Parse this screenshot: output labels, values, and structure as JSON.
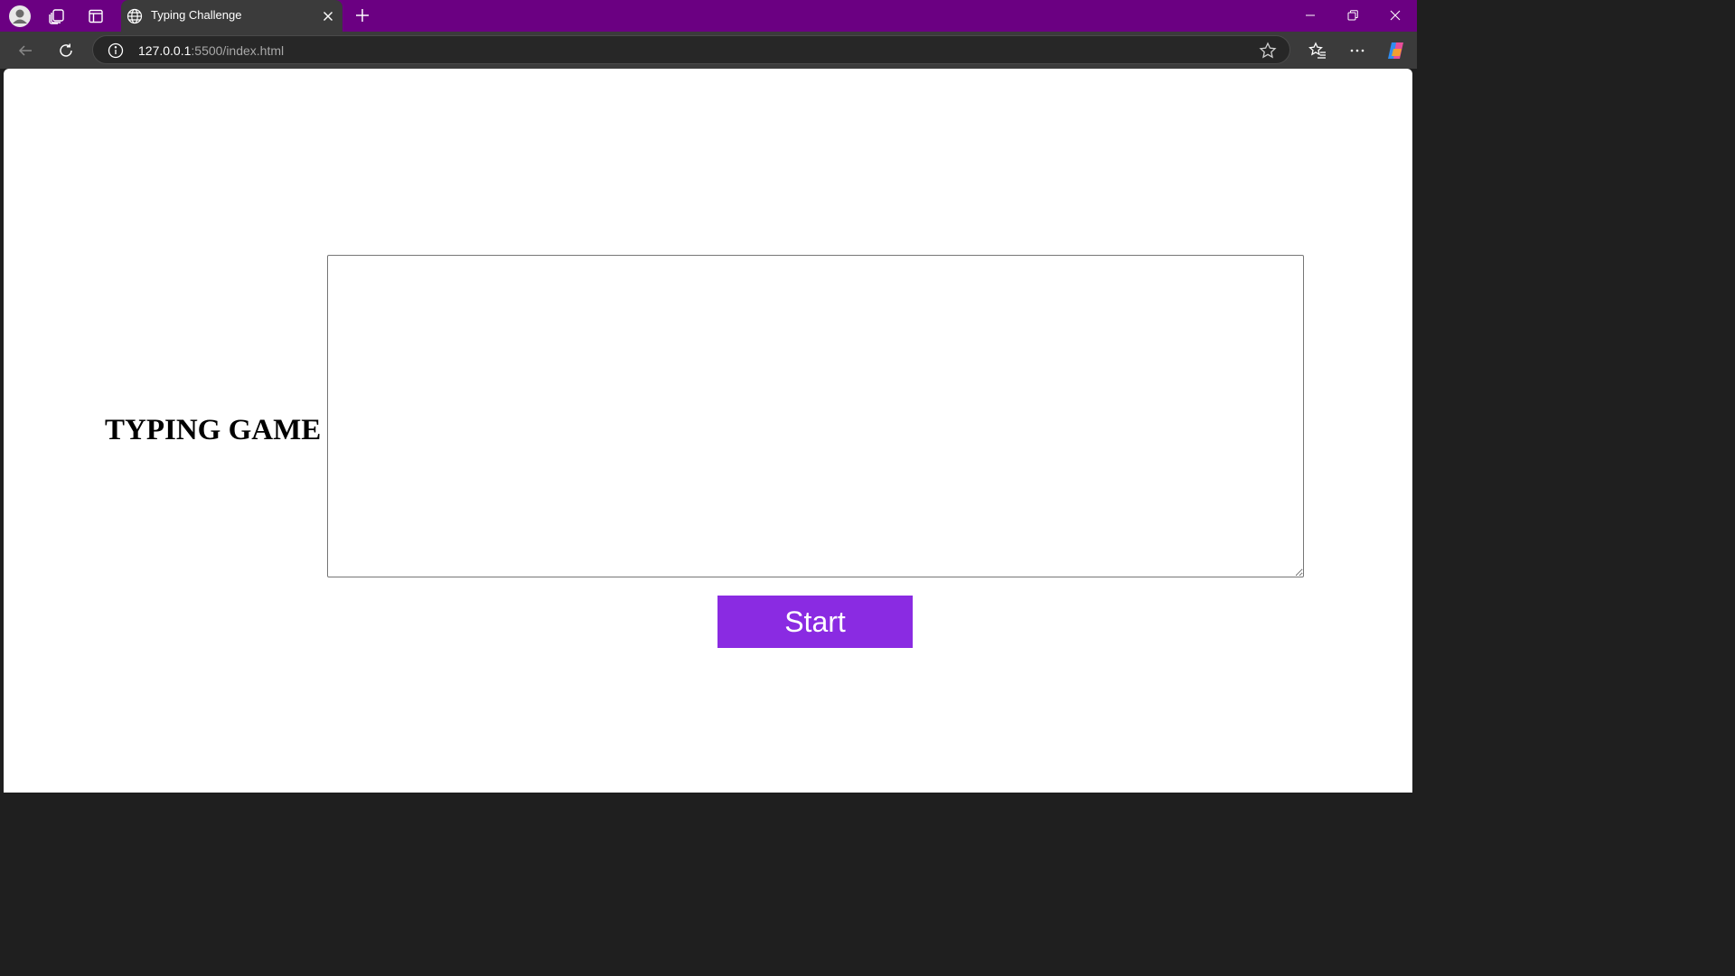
{
  "browser": {
    "tab": {
      "title": "Typing Challenge"
    },
    "address": {
      "host": "127.0.0.1",
      "rest": ":5500/index.html"
    },
    "theme": {
      "frame": "#6b0082",
      "toolbar": "#3b3b3b"
    }
  },
  "page": {
    "title": "TYPING GAME",
    "typing_area": {
      "value": "",
      "placeholder": ""
    },
    "start_button": {
      "label": "Start",
      "color": "#8a2be2"
    }
  },
  "icons": [
    "profile-icon",
    "workspaces-icon",
    "tab-actions-icon",
    "globe-icon",
    "close-tab-icon",
    "new-tab-icon",
    "minimize-icon",
    "restore-icon",
    "close-window-icon",
    "back-icon",
    "refresh-icon",
    "info-icon",
    "favorite-star-icon",
    "favorites-icon",
    "more-icon",
    "copilot-icon"
  ]
}
